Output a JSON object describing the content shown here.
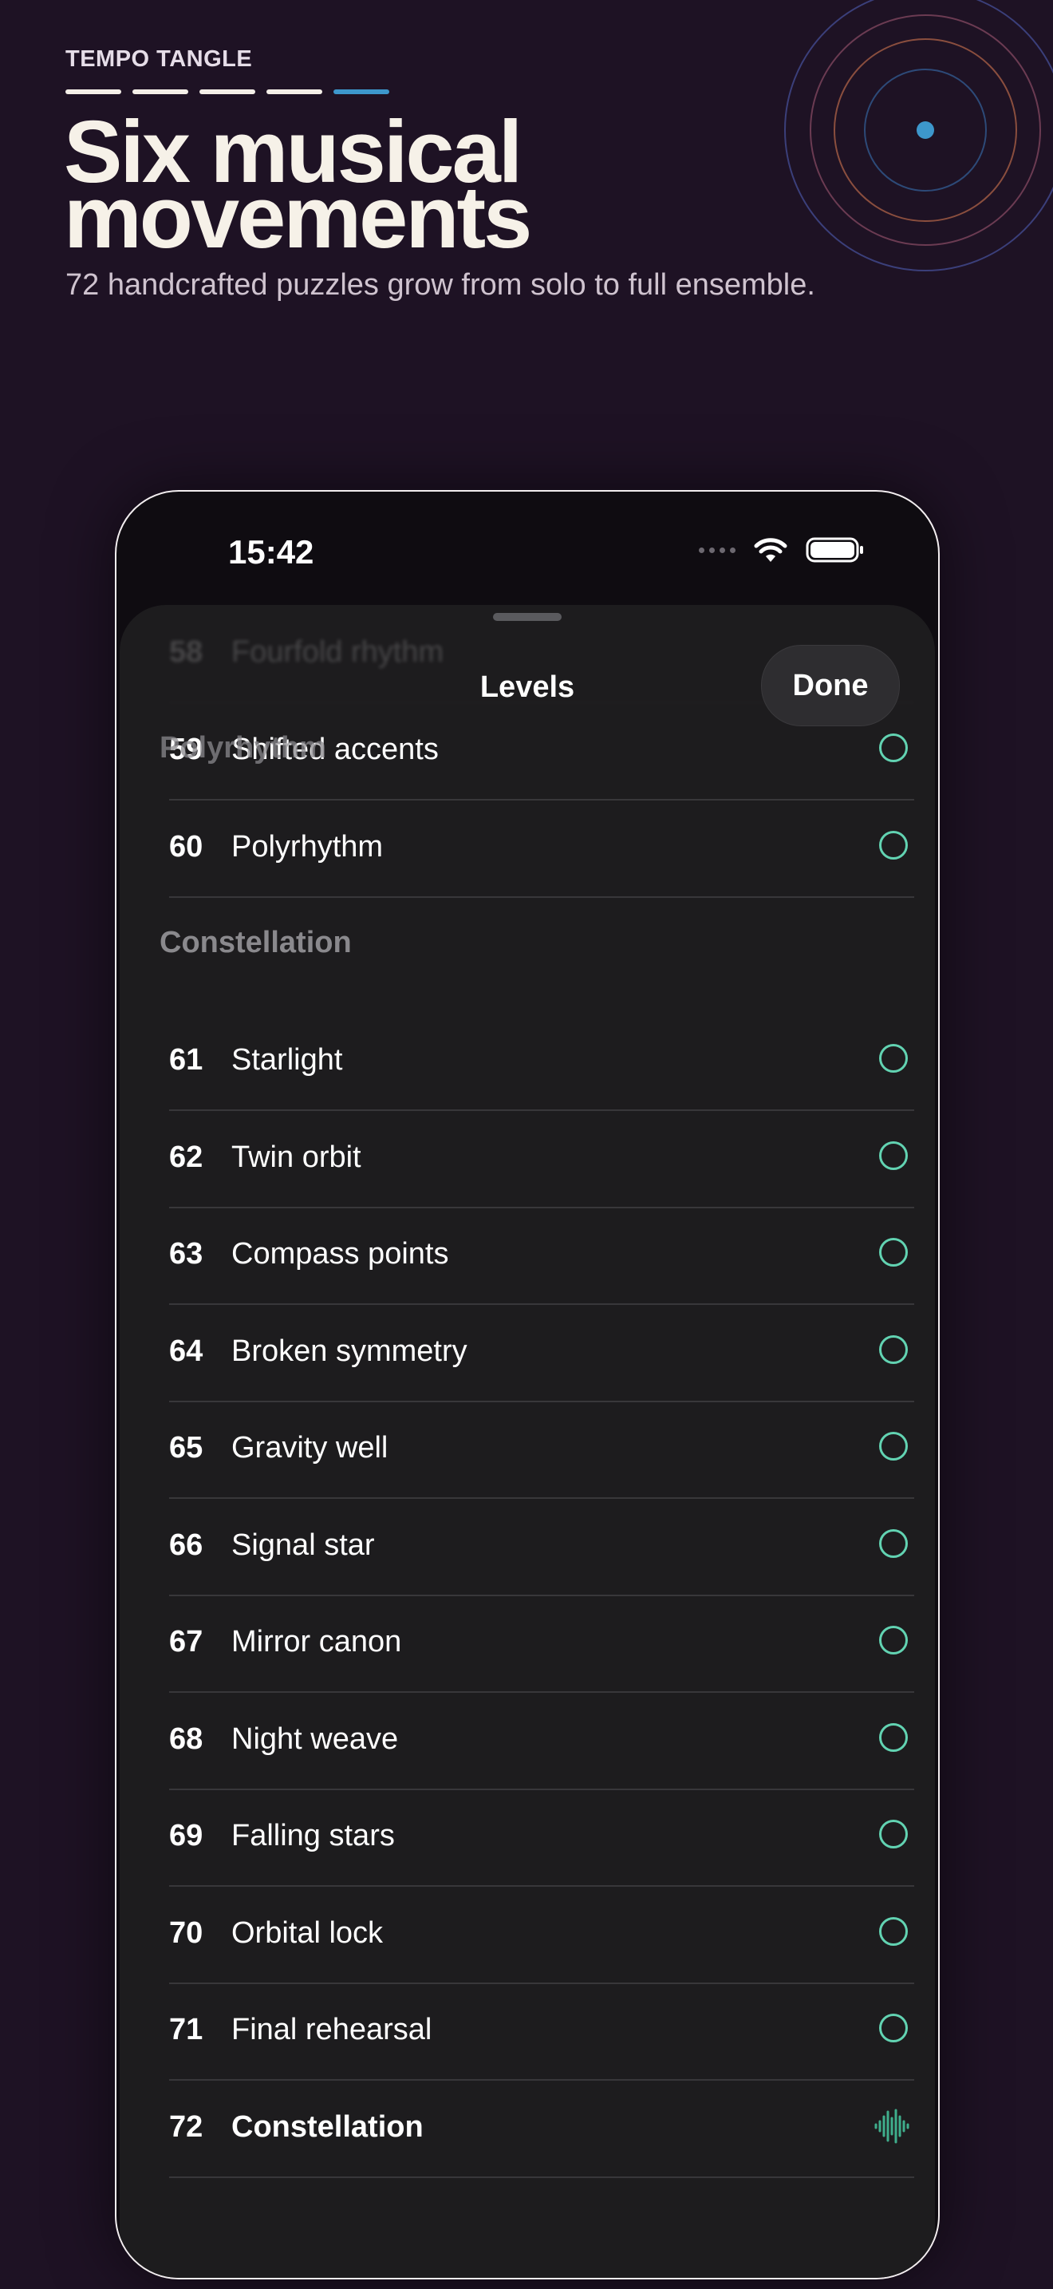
{
  "header": {
    "brand": "TEMPO TANGLE",
    "headline_line1": "Six musical",
    "headline_line2": "movements",
    "subhead": "72 handcrafted puzzles grow from solo to full ensemble.",
    "dash_accent": "#3d97cc"
  },
  "status_bar": {
    "time": "15:42"
  },
  "sheet": {
    "title": "Levels",
    "done_label": "Done"
  },
  "sections": {
    "polyrhythm": "Polyrhythm",
    "constellation": "Constellation"
  },
  "faded_row": {
    "num": "58",
    "name": "Fourfold rhythm"
  },
  "levels": [
    {
      "num": "59",
      "name": "Shifted accents"
    },
    {
      "num": "60",
      "name": "Polyrhythm"
    },
    {
      "num": "61",
      "name": "Starlight"
    },
    {
      "num": "62",
      "name": "Twin orbit"
    },
    {
      "num": "63",
      "name": "Compass points"
    },
    {
      "num": "64",
      "name": "Broken symmetry"
    },
    {
      "num": "65",
      "name": "Gravity well"
    },
    {
      "num": "66",
      "name": "Signal star"
    },
    {
      "num": "67",
      "name": "Mirror canon"
    },
    {
      "num": "68",
      "name": "Night weave"
    },
    {
      "num": "69",
      "name": "Falling stars"
    },
    {
      "num": "70",
      "name": "Orbital lock"
    },
    {
      "num": "71",
      "name": "Final rehearsal"
    },
    {
      "num": "72",
      "name": "Constellation",
      "current": true,
      "icon": "waveform-icon"
    }
  ],
  "colors": {
    "background": "#1e1224",
    "sheet": "#1d1c1e",
    "status_circle": "#62d3b2"
  }
}
